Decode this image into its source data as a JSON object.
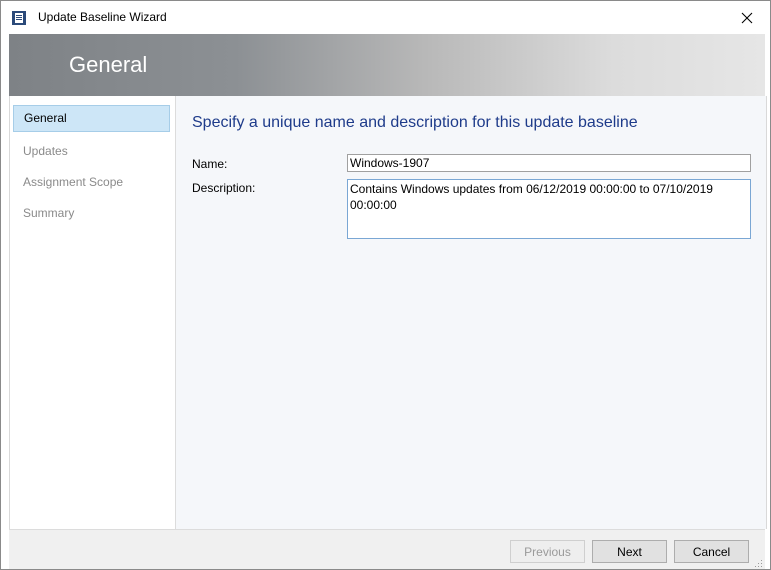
{
  "window": {
    "title": "Update Baseline Wizard",
    "close_icon": "close-icon",
    "app_icon": "wizard-app-icon"
  },
  "banner": {
    "title": "General"
  },
  "nav": {
    "items": [
      {
        "label": "General",
        "active": true
      },
      {
        "label": "Updates",
        "active": false
      },
      {
        "label": "Assignment Scope",
        "active": false
      },
      {
        "label": "Summary",
        "active": false
      }
    ]
  },
  "main": {
    "heading": "Specify a unique name and description for this update baseline",
    "name_label": "Name:",
    "name_value": "Windows-1907",
    "description_label": "Description:",
    "description_value": "Contains Windows updates from 06/12/2019 00:00:00 to 07/10/2019 00:00:00"
  },
  "footer": {
    "previous_label": "Previous",
    "next_label": "Next",
    "cancel_label": "Cancel"
  },
  "colors": {
    "accent": "#1e3b8a",
    "nav_selected": "#cde6f7"
  }
}
